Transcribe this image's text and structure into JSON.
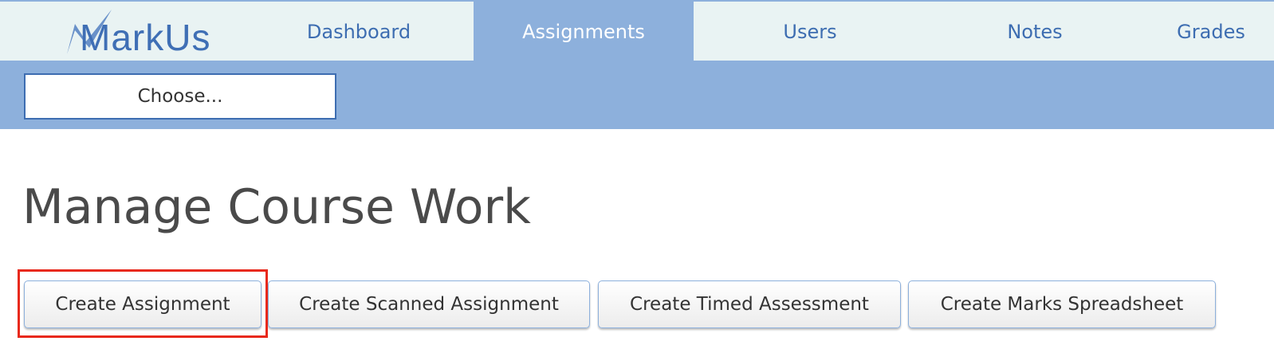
{
  "app": {
    "logo_text": "MarkUs"
  },
  "nav": {
    "items": [
      {
        "label": "Dashboard",
        "active": false
      },
      {
        "label": "Assignments",
        "active": true
      },
      {
        "label": "Users",
        "active": false
      },
      {
        "label": "Notes",
        "active": false
      },
      {
        "label": "Grades",
        "active": false
      }
    ]
  },
  "subnav": {
    "choose_label": "Choose..."
  },
  "page": {
    "title": "Manage Course Work"
  },
  "actions": {
    "create_assignment": "Create Assignment",
    "create_scanned_assignment": "Create Scanned Assignment",
    "create_timed_assessment": "Create Timed Assessment",
    "create_marks_spreadsheet": "Create Marks Spreadsheet"
  },
  "colors": {
    "accent_blue": "#8db0dc",
    "link_blue": "#3d6db1",
    "highlight_red": "#e8291c",
    "topbar_bg": "#e9f3f3"
  }
}
